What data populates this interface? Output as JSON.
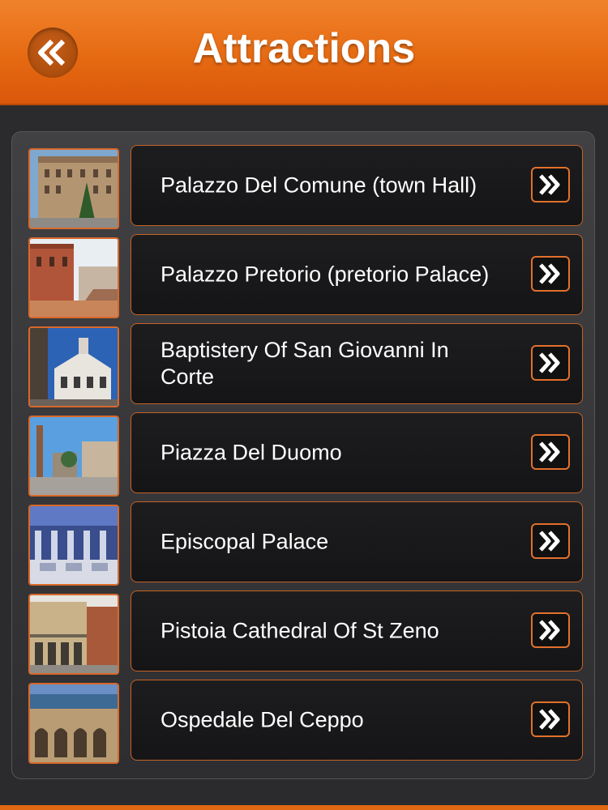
{
  "header": {
    "title": "Attractions",
    "back_icon": "double-chevron-left-icon",
    "accent_color": "#e8701a"
  },
  "list": {
    "items": [
      {
        "label": "Palazzo Del Comune (town Hall)",
        "thumb": "palazzo-comune-photo"
      },
      {
        "label": "Palazzo Pretorio (pretorio Palace)",
        "thumb": "palazzo-pretorio-photo"
      },
      {
        "label": "Baptistery Of San Giovanni In Corte",
        "thumb": "baptistery-photo"
      },
      {
        "label": "Piazza Del Duomo",
        "thumb": "piazza-duomo-photo"
      },
      {
        "label": "Episcopal Palace",
        "thumb": "episcopal-palace-photo"
      },
      {
        "label": "Pistoia Cathedral Of St Zeno",
        "thumb": "cathedral-photo"
      },
      {
        "label": "Ospedale Del Ceppo",
        "thumb": "ospedale-photo"
      }
    ],
    "arrow_icon": "double-chevron-right-icon"
  }
}
